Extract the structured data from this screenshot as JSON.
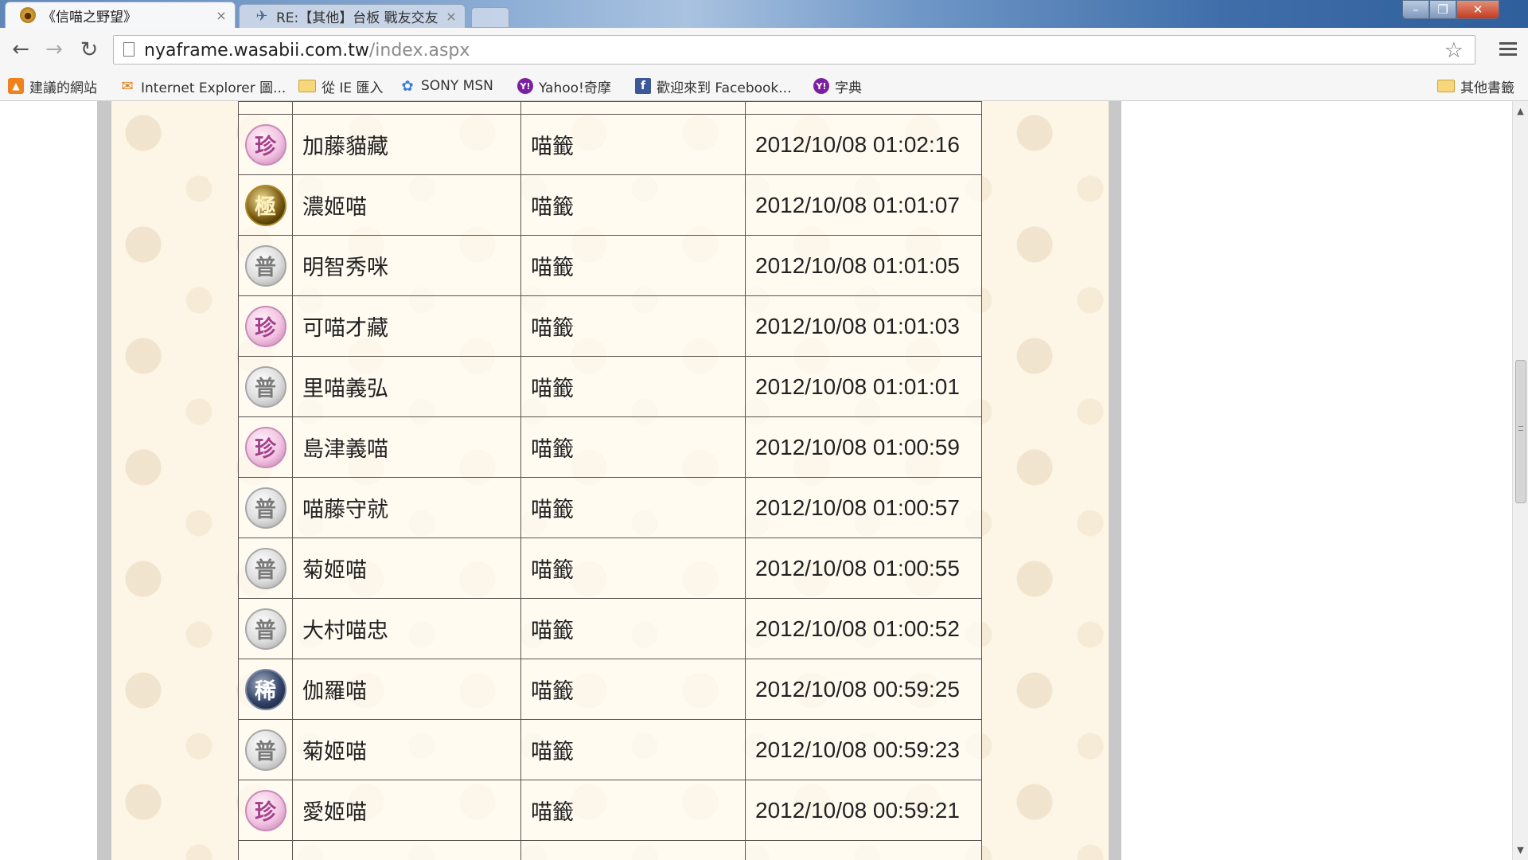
{
  "browser": {
    "tabs": [
      {
        "title": "《信喵之野望》",
        "active": true
      },
      {
        "title": "RE:【其他】台板 戰友交友",
        "active": false
      }
    ],
    "address": {
      "host": "nyaframe.wasabii.com.tw",
      "path": "/index.aspx"
    },
    "bookmarks": [
      {
        "label": "建議的網站",
        "icon": "suggested-sites-icon"
      },
      {
        "label": "Internet Explorer 圖...",
        "icon": "mail-icon"
      },
      {
        "label": "從 IE 匯入",
        "icon": "folder-icon"
      },
      {
        "label": "SONY MSN",
        "icon": "msn-icon"
      },
      {
        "label": "Yahoo!奇摩",
        "icon": "yahoo-icon"
      },
      {
        "label": "歡迎來到 Facebook...",
        "icon": "facebook-icon"
      },
      {
        "label": "字典",
        "icon": "yahoo-icon"
      }
    ],
    "other_bookmarks": "其他書籤",
    "glyphs": {
      "back": "←",
      "forward": "→",
      "reload": "↻",
      "star": "☆",
      "close": "×",
      "minimize": "–",
      "restore": "❐",
      "window_close": "✕",
      "scroll_up": "▲",
      "scroll_down": "▼"
    }
  },
  "records": [
    {
      "badge": "珍",
      "rarity": "rare",
      "name": "加藤貓藏",
      "type": "喵籤",
      "time": "2012/10/08 01:02:16"
    },
    {
      "badge": "極",
      "rarity": "ultra",
      "name": "濃姬喵",
      "type": "喵籤",
      "time": "2012/10/08 01:01:07"
    },
    {
      "badge": "普",
      "rarity": "common",
      "name": "明智秀咪",
      "type": "喵籤",
      "time": "2012/10/08 01:01:05"
    },
    {
      "badge": "珍",
      "rarity": "rare",
      "name": "可喵才藏",
      "type": "喵籤",
      "time": "2012/10/08 01:01:03"
    },
    {
      "badge": "普",
      "rarity": "common",
      "name": "里喵義弘",
      "type": "喵籤",
      "time": "2012/10/08 01:01:01"
    },
    {
      "badge": "珍",
      "rarity": "rare",
      "name": "島津義喵",
      "type": "喵籤",
      "time": "2012/10/08 01:00:59"
    },
    {
      "badge": "普",
      "rarity": "common",
      "name": "喵藤守就",
      "type": "喵籤",
      "time": "2012/10/08 01:00:57"
    },
    {
      "badge": "普",
      "rarity": "common",
      "name": "菊姬喵",
      "type": "喵籤",
      "time": "2012/10/08 01:00:55"
    },
    {
      "badge": "普",
      "rarity": "common",
      "name": "大村喵忠",
      "type": "喵籤",
      "time": "2012/10/08 01:00:52"
    },
    {
      "badge": "稀",
      "rarity": "epic",
      "name": "伽羅喵",
      "type": "喵籤",
      "time": "2012/10/08 00:59:25"
    },
    {
      "badge": "普",
      "rarity": "common",
      "name": "菊姬喵",
      "type": "喵籤",
      "time": "2012/10/08 00:59:23"
    },
    {
      "badge": "珍",
      "rarity": "rare",
      "name": "愛姬喵",
      "type": "喵籤",
      "time": "2012/10/08 00:59:21"
    }
  ],
  "colors": {
    "parchment": "#fdf6e6",
    "table_border": "#5a5550",
    "rare_badge": "#c274aa",
    "ultra_badge": "#7a5d12",
    "epic_badge": "#334468",
    "common_badge": "#9e9e9e"
  }
}
